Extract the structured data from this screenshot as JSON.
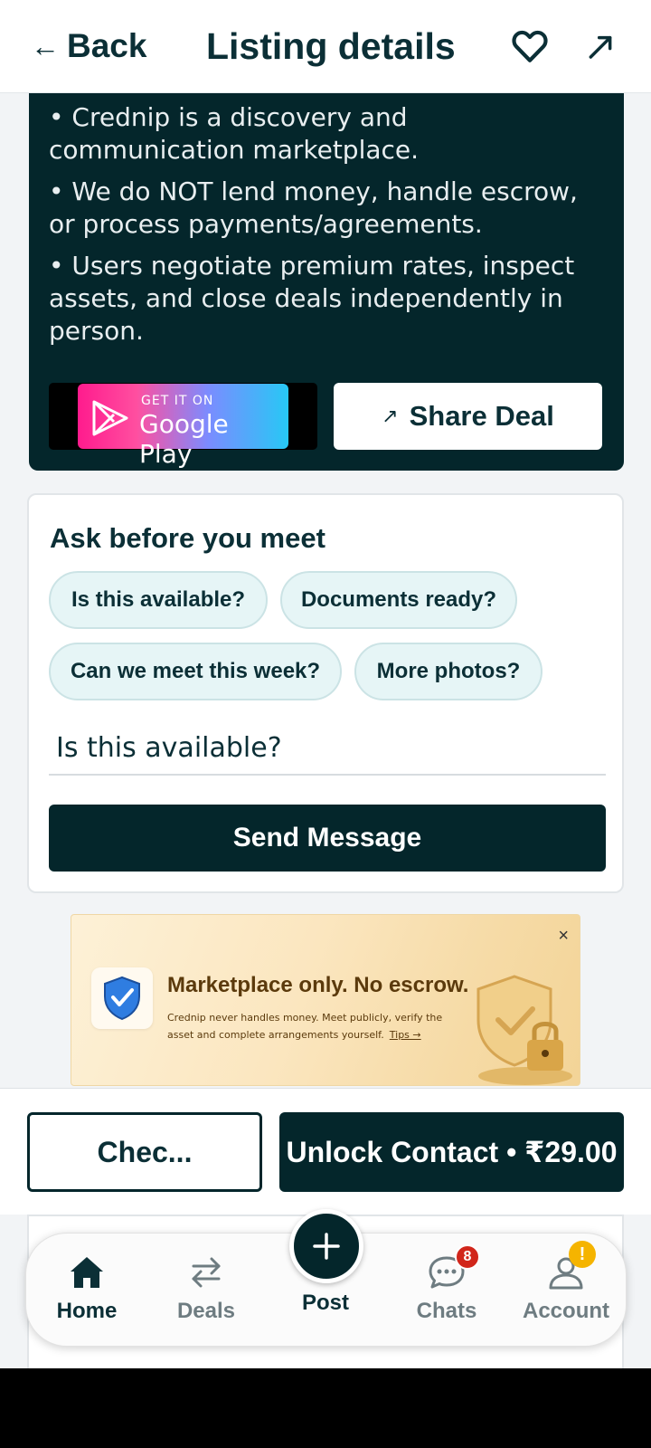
{
  "header": {
    "back_label": "Back",
    "title": "Listing details"
  },
  "info": {
    "bullets": [
      "Crednip is a discovery and communication marketplace.",
      "We do NOT lend money, handle escrow, or process payments/agreements.",
      "Users negotiate premium rates, inspect assets, and close deals independently in person."
    ],
    "google_play": {
      "top": "GET IT ON",
      "bottom": "Google Play"
    },
    "share_deal_label": "Share Deal"
  },
  "ask": {
    "title": "Ask before you meet",
    "chips": [
      "Is this available?",
      "Documents ready?",
      "Can we meet this week?",
      "More photos?"
    ],
    "message_value": "Is this available?",
    "send_label": "Send Message"
  },
  "banner": {
    "title": "Marketplace only. No escrow.",
    "text": "Crednip never handles money. Meet publicly, verify the asset and complete arrangements yourself.",
    "tips_label": "Tips →",
    "close_symbol": "×"
  },
  "actions": {
    "check_label": "Chec...",
    "unlock_label": "Unlock Contact • ₹29.00"
  },
  "nav": {
    "items": [
      {
        "label": "Home",
        "icon": "home-icon",
        "active": true
      },
      {
        "label": "Deals",
        "icon": "swap-icon",
        "active": false
      },
      {
        "label": "Post",
        "icon": "plus-icon",
        "active": false
      },
      {
        "label": "Chats",
        "icon": "chat-icon",
        "badge": "8",
        "active": false
      },
      {
        "label": "Account",
        "icon": "user-icon",
        "badge": "!",
        "active": false
      }
    ]
  },
  "colors": {
    "primary": "#04262b",
    "chip_bg": "#e6f5f6",
    "badge_red": "#d1261b",
    "badge_warning": "#f5b400"
  }
}
